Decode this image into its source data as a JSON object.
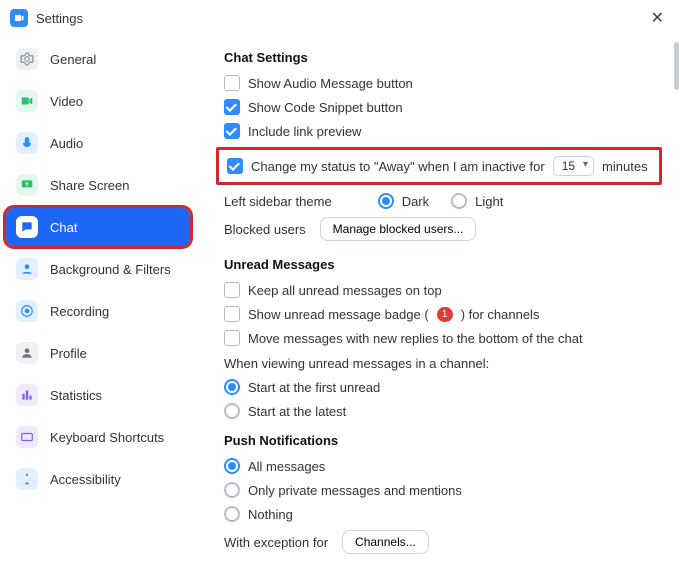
{
  "window": {
    "title": "Settings"
  },
  "sidebar": {
    "items": [
      {
        "label": "General"
      },
      {
        "label": "Video"
      },
      {
        "label": "Audio"
      },
      {
        "label": "Share Screen"
      },
      {
        "label": "Chat"
      },
      {
        "label": "Background & Filters"
      },
      {
        "label": "Recording"
      },
      {
        "label": "Profile"
      },
      {
        "label": "Statistics"
      },
      {
        "label": "Keyboard Shortcuts"
      },
      {
        "label": "Accessibility"
      }
    ]
  },
  "chat_settings": {
    "heading": "Chat Settings",
    "show_audio": "Show Audio Message button",
    "show_code": "Show Code Snippet button",
    "include_link": "Include link preview",
    "away_prefix": "Change my status to \"Away\" when I am inactive for",
    "away_minutes": "15",
    "away_suffix": "minutes",
    "sidebar_theme_label": "Left sidebar theme",
    "theme_dark": "Dark",
    "theme_light": "Light",
    "blocked_label": "Blocked users",
    "blocked_btn": "Manage blocked users..."
  },
  "unread": {
    "heading": "Unread Messages",
    "keep_top": "Keep all unread messages on top",
    "badge_prefix": "Show unread message badge (",
    "badge_count": "1",
    "badge_suffix": ") for channels",
    "move_replies": "Move messages with new replies to the bottom of the chat",
    "viewing_label": "When viewing unread messages in a channel:",
    "first_unread": "Start at the first unread",
    "latest": "Start at the latest"
  },
  "push": {
    "heading": "Push Notifications",
    "all": "All messages",
    "private": "Only private messages and mentions",
    "nothing": "Nothing",
    "exception_label": "With exception for",
    "channels_btn": "Channels..."
  }
}
